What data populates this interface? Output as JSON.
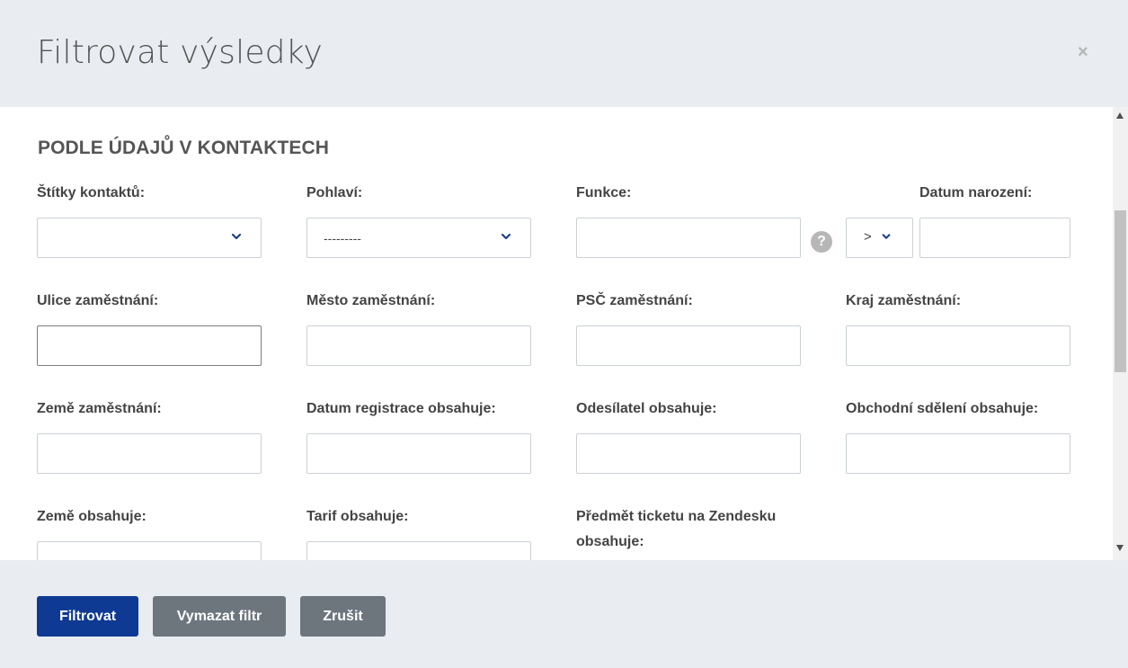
{
  "modal": {
    "title": "Filtrovat výsledky",
    "close_symbol": "×"
  },
  "section": {
    "title": "PODLE ÚDAJŮ V KONTAKTECH"
  },
  "fields": {
    "stitky": {
      "label": "Štítky kontaktů:",
      "value": ""
    },
    "pohlavi": {
      "label": "Pohlaví:",
      "value": "---------"
    },
    "funkce": {
      "label": "Funkce:",
      "value": ""
    },
    "datum_narozeni": {
      "label": "Datum narození:",
      "operator": ">",
      "value": ""
    },
    "ulice": {
      "label": "Ulice zaměstnání:",
      "value": ""
    },
    "mesto": {
      "label": "Město zaměstnání:",
      "value": ""
    },
    "psc": {
      "label": "PSČ zaměstnání:",
      "value": "",
      "help": "?"
    },
    "kraj": {
      "label": "Kraj zaměstnání:",
      "value": ""
    },
    "zeme_zam": {
      "label": "Země zaměstnání:",
      "value": ""
    },
    "datum_reg": {
      "label": "Datum registrace obsahuje:",
      "value": ""
    },
    "odesilatel": {
      "label": "Odesílatel obsahuje:",
      "value": ""
    },
    "obchodni": {
      "label": "Obchodní sdělení obsahuje:",
      "value": ""
    },
    "zeme_obs": {
      "label": "Země obsahuje:",
      "value": ""
    },
    "tarif": {
      "label": "Tarif obsahuje:",
      "value": ""
    },
    "predmet": {
      "label_line1": "Předmět ticketu na Zendesku",
      "label_line2": "obsahuje:",
      "value": ""
    }
  },
  "footer": {
    "filter_label": "Filtrovat",
    "clear_label": "Vymazat filtr",
    "cancel_label": "Zrušit"
  },
  "colors": {
    "primary": "#0f3a94",
    "secondary": "#6d757d",
    "header_bg": "#e9edf1"
  }
}
